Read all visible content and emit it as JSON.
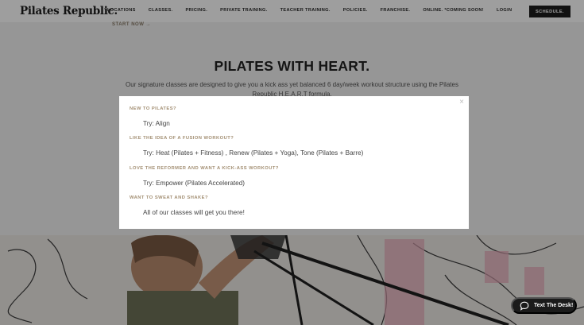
{
  "header": {
    "logo": "Pilates Republic.",
    "nav": [
      "LOCATIONS",
      "CLASSES.",
      "PRICING.",
      "PRIVATE TRAINING.",
      "TEACHER TRAINING.",
      "POLICIES.",
      "FRANCHISE.",
      "ONLINE. *COMING SOON!",
      "LOGIN"
    ],
    "schedule_label": "SCHEDULE."
  },
  "start_now": "START NOW →",
  "hero": {
    "title": "PILATES WITH HEART.",
    "body": "Our signature classes are designed to give you a kick ass yet balanced 6 day/week workout structure using the Pilates Republic H.E.A.R.T formula."
  },
  "modal": {
    "close": "×",
    "items": [
      {
        "question": "NEW TO PILATES?",
        "answer": "Try: Align"
      },
      {
        "question": "LIKE THE IDEA OF A FUSION WORKOUT?",
        "answer": "Try: Heat (Pilates + Fitness) , Renew (Pilates + Yoga), Tone (Pilates + Barre)"
      },
      {
        "question": "LOVE THE REFORMER AND WANT A KICK-ASS WORKOUT?",
        "answer": "Try: Empower (Pilates Accelerated)"
      },
      {
        "question": "WANT TO SWEAT AND SHAKE?",
        "answer": "All of our classes will get you there!"
      }
    ]
  },
  "chat": {
    "label": "Text The Desk!",
    "icon": "chat-bubble-icon"
  },
  "colors": {
    "accent": "#a38f73",
    "dark": "#1c1c1c"
  }
}
